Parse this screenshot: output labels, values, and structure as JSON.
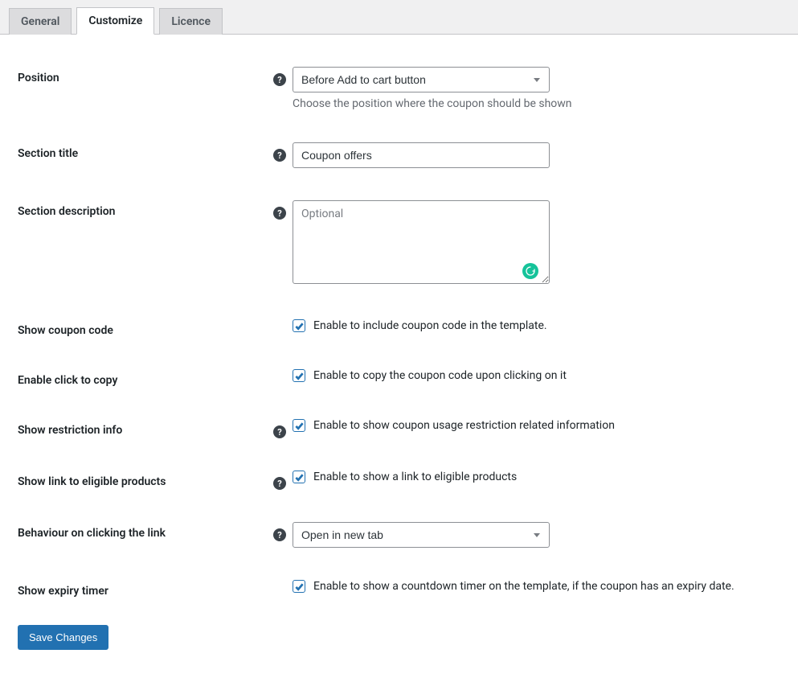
{
  "tabs": {
    "general": "General",
    "customize": "Customize",
    "licence": "Licence"
  },
  "fields": {
    "position": {
      "label": "Position",
      "value": "Before Add to cart button",
      "desc": "Choose the position where the coupon should be shown"
    },
    "sectionTitle": {
      "label": "Section title",
      "value": "Coupon offers"
    },
    "sectionDescription": {
      "label": "Section description",
      "placeholder": "Optional"
    },
    "showCouponCode": {
      "label": "Show coupon code",
      "desc": "Enable to include coupon code in the template."
    },
    "enableClickToCopy": {
      "label": "Enable click to copy",
      "desc": "Enable to copy the coupon code upon clicking on it"
    },
    "showRestrictionInfo": {
      "label": "Show restriction info",
      "desc": "Enable to show coupon usage restriction related information"
    },
    "showLinkEligible": {
      "label": "Show link to eligible products",
      "desc": "Enable to show a link to eligible products"
    },
    "behaviourLink": {
      "label": "Behaviour on clicking the link",
      "value": "Open in new tab"
    },
    "showExpiryTimer": {
      "label": "Show expiry timer",
      "desc": "Enable to show a countdown timer on the template, if the coupon has an expiry date."
    }
  },
  "buttons": {
    "save": "Save Changes"
  },
  "helpGlyph": "?"
}
